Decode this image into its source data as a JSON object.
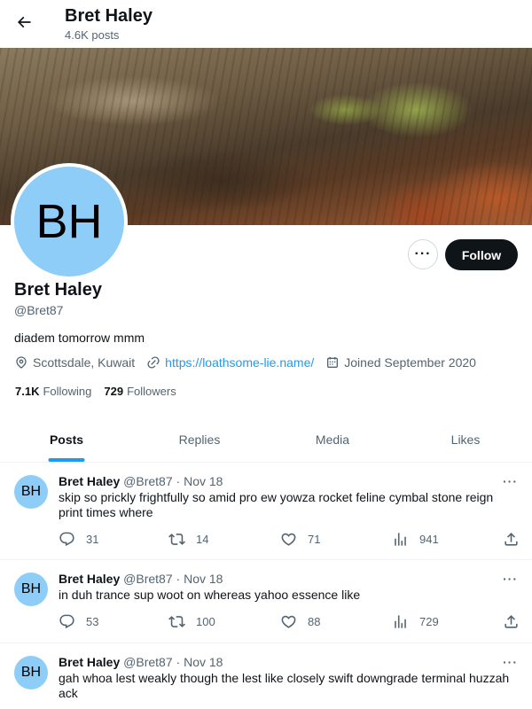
{
  "header": {
    "back_icon": "arrow-left-icon",
    "name": "Bret Haley",
    "post_count": "4.6K posts"
  },
  "profile": {
    "avatar_initials": "BH",
    "avatar_color": "#8ecdf8",
    "more_icon": "ellipsis-icon",
    "more_label": "···",
    "follow_label": "Follow",
    "name": "Bret Haley",
    "handle": "@Bret87",
    "bio": "diadem tomorrow mmm",
    "location": "Scottsdale, Kuwait",
    "website": "https://loathsome-lie.name/",
    "joined": "Joined September 2020",
    "following_count": "7.1K",
    "following_label": "Following",
    "followers_count": "729",
    "followers_label": "Followers"
  },
  "tabs": [
    {
      "label": "Posts",
      "active": true
    },
    {
      "label": "Replies",
      "active": false
    },
    {
      "label": "Media",
      "active": false
    },
    {
      "label": "Likes",
      "active": false
    }
  ],
  "tweets": [
    {
      "avatar": "BH",
      "name": "Bret Haley",
      "handle": "@Bret87",
      "separator": "·",
      "date": "Nov 18",
      "more": "···",
      "text": "skip so prickly frightfully so amid pro ew yowza rocket feline cymbal stone reign print times where",
      "replies": "31",
      "reposts": "14",
      "likes": "71",
      "views": "941"
    },
    {
      "avatar": "BH",
      "name": "Bret Haley",
      "handle": "@Bret87",
      "separator": "·",
      "date": "Nov 18",
      "more": "···",
      "text": "in duh trance sup woot on whereas yahoo essence like",
      "replies": "53",
      "reposts": "100",
      "likes": "88",
      "views": "729"
    },
    {
      "avatar": "BH",
      "name": "Bret Haley",
      "handle": "@Bret87",
      "separator": "·",
      "date": "Nov 18",
      "more": "···",
      "text": "gah whoa lest weakly though the lest like closely swift downgrade terminal huzzah ack",
      "replies": "",
      "reposts": "",
      "likes": "",
      "views": ""
    }
  ],
  "colors": {
    "accent": "#1d9bf0",
    "text": "#0f1419",
    "muted": "#536471",
    "follow_bg": "#0f1419"
  }
}
